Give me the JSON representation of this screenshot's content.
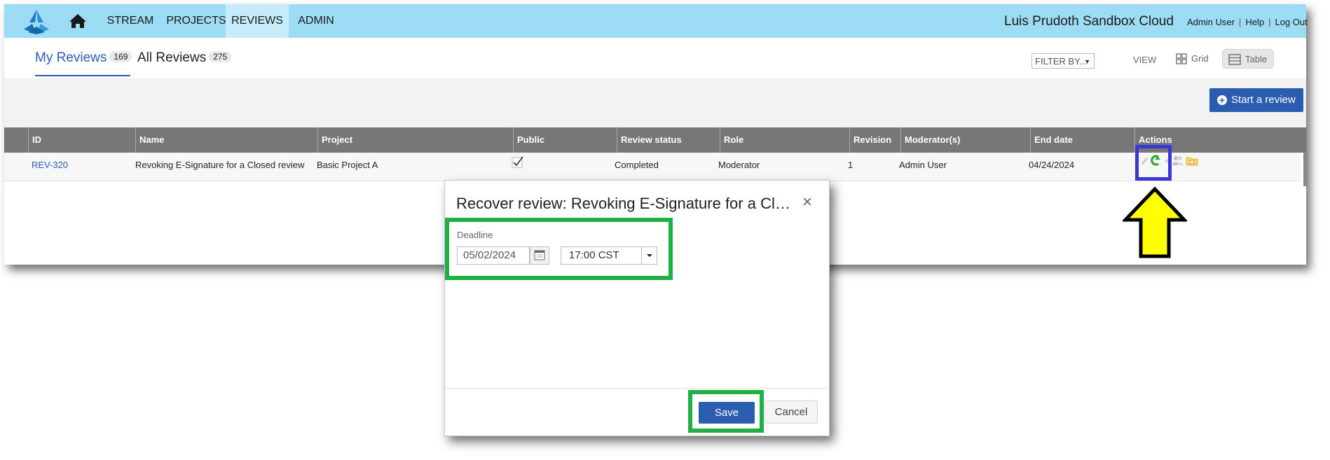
{
  "app": {
    "nav": {
      "stream": "STREAM",
      "projects": "PROJECTS",
      "reviews": "REVIEWS",
      "admin": "ADMIN"
    },
    "cloud_title": "Luis Prudoth Sandbox Cloud",
    "user_links": {
      "user": "Admin User",
      "help": "Help",
      "logout": "Log Out"
    }
  },
  "tabs": {
    "my_reviews": "My Reviews",
    "my_reviews_count": "169",
    "all_reviews": "All Reviews",
    "all_reviews_count": "275"
  },
  "toolbar": {
    "filter_label": "FILTER BY...",
    "view_label": "VIEW",
    "grid_label": "Grid",
    "table_label": "Table",
    "start_review_label": "Start a review"
  },
  "table": {
    "headers": [
      "ID",
      "Name",
      "Project",
      "Public",
      "Review status",
      "Role",
      "Revision",
      "Moderator(s)",
      "End date",
      "Actions"
    ],
    "rows": [
      {
        "id": "REV-320",
        "name": "Revoking E-Signature for a Closed review",
        "project": "Basic Project A",
        "public_checked": true,
        "status": "Completed",
        "role": "Moderator",
        "revision": "1",
        "moderators": "Admin User",
        "end_date": "04/24/2024",
        "actions": [
          "edit-icon",
          "recover-icon",
          "users-icon",
          "folder-lock-icon"
        ]
      }
    ]
  },
  "modal": {
    "title": "Recover review: Revoking E-Signature for a Closed review",
    "close_symbol": "×",
    "deadline_label": "Deadline",
    "date_value": "05/02/2024",
    "time_value": "17:00 CST",
    "save_label": "Save",
    "cancel_label": "Cancel"
  },
  "colors": {
    "topbar": "#9ddcf5",
    "accent": "#2a5db0",
    "table_header": "#777777",
    "annotation_green": "#1fb045",
    "annotation_blue": "#3838d6",
    "annotation_arrow": "#ffff00"
  }
}
